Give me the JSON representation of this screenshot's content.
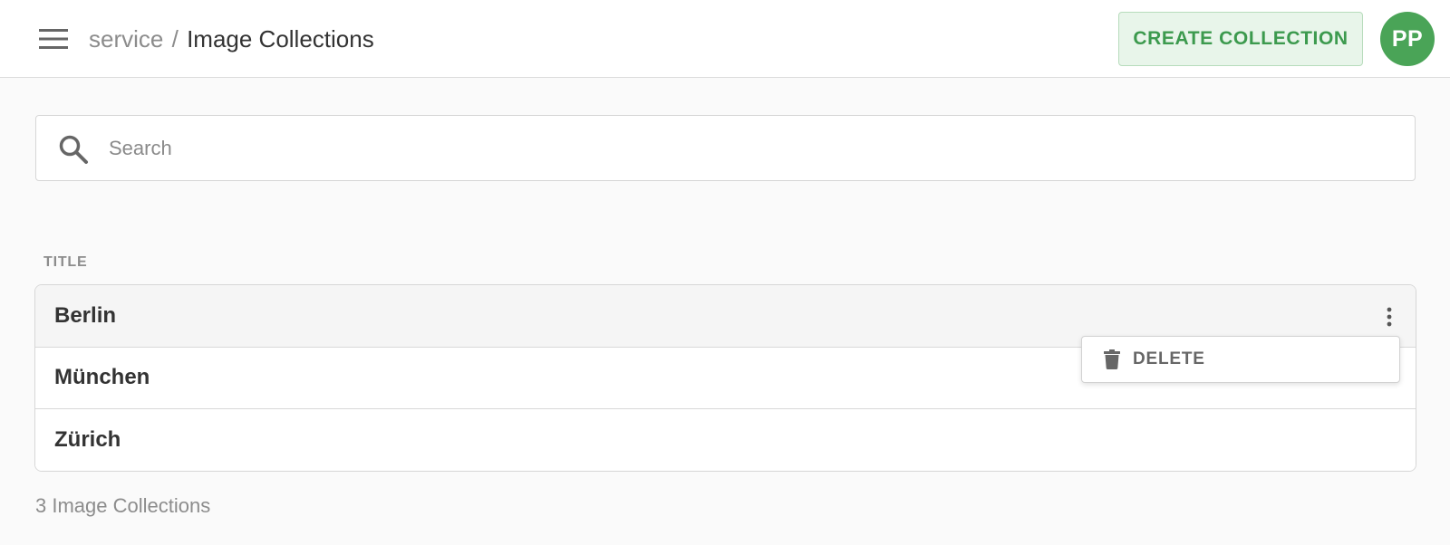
{
  "header": {
    "breadcrumb_root": "service",
    "breadcrumb_separator": "/",
    "breadcrumb_current": "Image Collections",
    "create_button_label": "CREATE COLLECTION",
    "avatar_initials": "PP",
    "menu_icon": "hamburger-menu-icon"
  },
  "search": {
    "placeholder": "Search",
    "value": "",
    "icon": "search-icon"
  },
  "table": {
    "column_header": "TITLE",
    "rows": [
      {
        "title": "Berlin"
      },
      {
        "title": "München"
      },
      {
        "title": "Zürich"
      }
    ]
  },
  "row_menu": {
    "items": [
      {
        "label": "DELETE",
        "icon": "trash-icon"
      }
    ]
  },
  "footer": {
    "count_label": "3 Image Collections"
  },
  "colors": {
    "accent_green": "#4aa457",
    "create_button_bg": "#e8f5ea",
    "create_button_text": "#3c9a4e",
    "page_bg": "#fafafa"
  }
}
